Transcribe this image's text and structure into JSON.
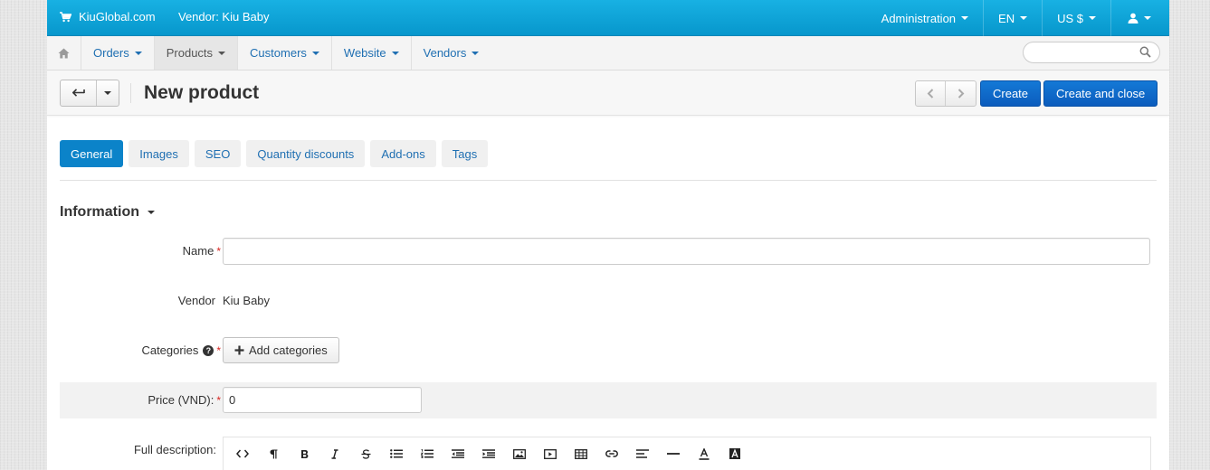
{
  "topbar": {
    "brand": "KiuGlobal.com",
    "vendor": "Vendor: Kiu Baby",
    "admin": "Administration",
    "language": "EN",
    "currency": "US $",
    "user_icon": "user-icon"
  },
  "nav": {
    "items": [
      {
        "label": "Orders",
        "active": false
      },
      {
        "label": "Products",
        "active": true
      },
      {
        "label": "Customers",
        "active": false
      },
      {
        "label": "Website",
        "active": false
      },
      {
        "label": "Vendors",
        "active": false
      }
    ],
    "search_placeholder": ""
  },
  "actionbar": {
    "title": "New product",
    "create": "Create",
    "create_close": "Create and close"
  },
  "tabs": [
    "General",
    "Images",
    "SEO",
    "Quantity discounts",
    "Add-ons",
    "Tags"
  ],
  "form": {
    "section": "Information",
    "name_label": "Name",
    "name_value": "",
    "vendor_label": "Vendor",
    "vendor_value": "Kiu Baby",
    "categories_label": "Categories",
    "add_categories": "Add categories",
    "price_label": "Price (VND):",
    "price_value": "0",
    "full_description_label": "Full description:",
    "required_mark": "*",
    "help_mark": "?"
  },
  "editor_tools": [
    "code-view-icon",
    "paragraph-icon",
    "bold-icon",
    "italic-icon",
    "strikethrough-icon",
    "unordered-list-icon",
    "ordered-list-icon",
    "outdent-icon",
    "indent-icon",
    "image-icon",
    "video-icon",
    "table-icon",
    "link-icon",
    "align-icon",
    "horizontal-rule-icon",
    "font-color-icon",
    "background-color-icon"
  ],
  "colors": {
    "topbar": "#0ea5dc",
    "primary": "#0b5cbd",
    "active_tab": "#0b83c9",
    "link": "#1f6fb2",
    "required": "#d9241f"
  }
}
